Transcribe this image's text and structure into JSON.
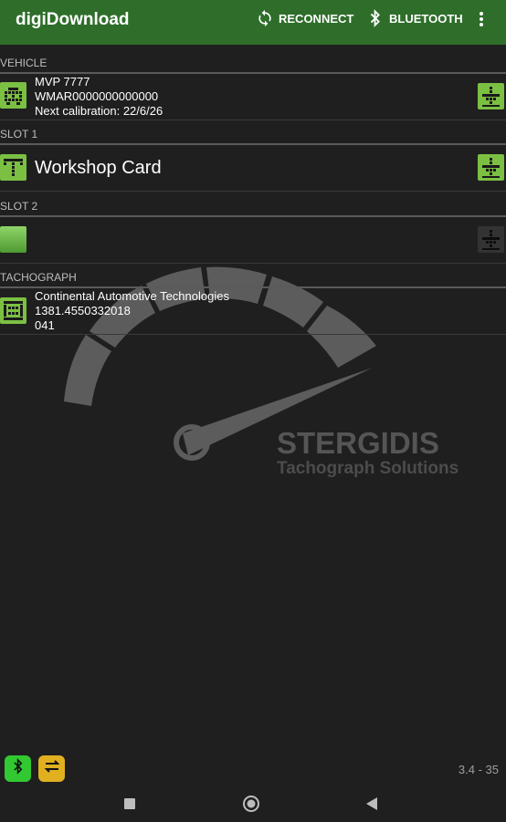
{
  "app": {
    "title": "digiDownload",
    "reconnect_label": "RECONNECT",
    "bluetooth_label": "BLUETOOTH",
    "accent": "#2e6e2a"
  },
  "sections": {
    "vehicle": "VEHICLE",
    "slot1": "SLOT 1",
    "slot2": "SLOT 2",
    "tachograph": "TACHOGRAPH"
  },
  "vehicle": {
    "registration": "MVP 7777",
    "vin": "WMAR0000000000000",
    "calibration": "Next calibration: 22/6/26"
  },
  "slot1": {
    "card": "Workshop Card"
  },
  "slot2": {
    "card": ""
  },
  "tachograph": {
    "manufacturer": "Continental Automotive Technologies",
    "serial": "1381.4550332018",
    "version": "041"
  },
  "watermark": {
    "brand": "STERGIDIS",
    "tagline": "Tachograph Solutions"
  },
  "footer": {
    "version": "3.4 - 35"
  },
  "icons": {
    "reconnect": "sync-icon",
    "bluetooth": "bluetooth-icon",
    "overflow": "more-vert-icon",
    "nav_recent": "square-icon",
    "nav_home": "circle-icon",
    "nav_back": "triangle-back-icon"
  }
}
